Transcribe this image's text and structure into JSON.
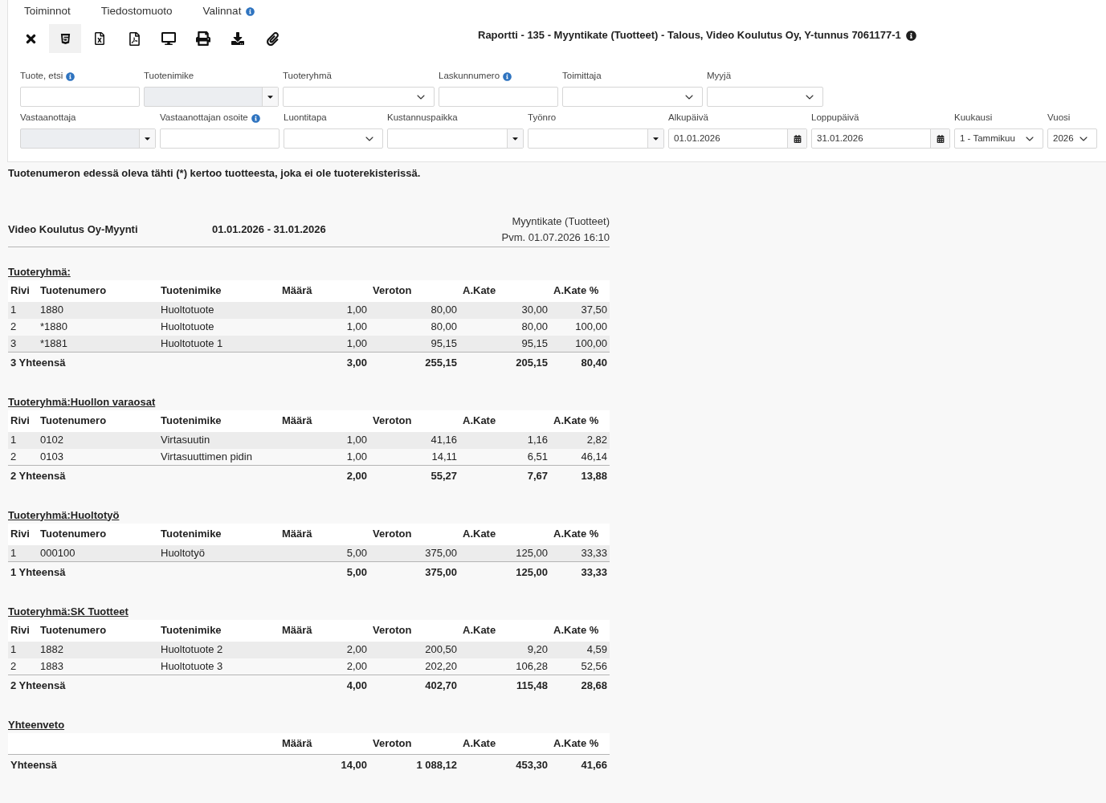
{
  "menu": [
    {
      "label": "Toiminnot",
      "info": false
    },
    {
      "label": "Tiedostomuoto",
      "info": false
    },
    {
      "label": "Valinnat",
      "info": true
    }
  ],
  "toolbar": [
    {
      "kind": "close",
      "selected": false
    },
    {
      "kind": "html",
      "selected": true
    },
    {
      "kind": "excel",
      "selected": false
    },
    {
      "kind": "pdf",
      "selected": false
    },
    {
      "kind": "screen",
      "selected": false
    },
    {
      "kind": "print",
      "selected": false
    },
    {
      "kind": "download",
      "selected": false
    },
    {
      "kind": "attach",
      "selected": false
    }
  ],
  "title": {
    "text": "Raportti - 135 - Myyntikate (Tuotteet) - Talous, Video Koulutus Oy, Y-tunnus 7061177-1",
    "info": true
  },
  "filter_rows": [
    [
      {
        "label": "Tuote, etsi",
        "info": true,
        "kind": "text",
        "disabled": false
      },
      {
        "label": "Tuotenimike",
        "info": false,
        "kind": "combo",
        "disabled": true
      },
      {
        "label": "Tuoteryhmä",
        "info": false,
        "kind": "select",
        "disabled": false
      },
      {
        "label": "Laskunnumero",
        "info": true,
        "kind": "text",
        "disabled": false
      },
      {
        "label": "Toimittaja",
        "info": false,
        "kind": "select",
        "disabled": false
      },
      {
        "label": "Myyjä",
        "info": false,
        "kind": "select",
        "disabled": false
      }
    ],
    [
      {
        "label": "Vastaanottaja",
        "info": false,
        "kind": "combo",
        "disabled": true
      },
      {
        "label": "Vastaanottajan osoite",
        "info": true,
        "kind": "text",
        "disabled": false
      },
      {
        "label": "Luontitapa",
        "info": false,
        "kind": "select",
        "disabled": false
      },
      {
        "label": "Kustannuspaikka",
        "info": false,
        "kind": "combo",
        "disabled": false
      },
      {
        "label": "Työnro",
        "info": false,
        "kind": "combo",
        "disabled": false
      },
      {
        "label": "Alkupäivä",
        "info": false,
        "kind": "date",
        "disabled": false,
        "value": "01.01.2026"
      },
      {
        "label": "Loppupäivä",
        "info": false,
        "kind": "date",
        "disabled": false,
        "value": "31.01.2026"
      },
      {
        "label": "Kuukausi",
        "info": false,
        "kind": "select",
        "disabled": false,
        "value": "1 - Tammikuu"
      },
      {
        "label": "Vuosi",
        "info": false,
        "kind": "select",
        "disabled": false,
        "value": "2026"
      }
    ]
  ],
  "note": "Tuotenumeron edessä oleva tähti (*) kertoo tuotteesta, joka ei ole tuoterekisterissä.",
  "report_header": {
    "company": "Video Koulutus Oy-Myynti",
    "period": "01.01.2026 - 31.01.2026",
    "report_name": "Myyntikate (Tuotteet)",
    "printed": "Pvm. 01.07.2026 16:10"
  },
  "groups": [
    {
      "heading": "Tuoteryhmä:",
      "columns": [
        "Rivi",
        "Tuotenumero",
        "Tuotenimike",
        "Määrä",
        "Veroton",
        "A.Kate",
        "A.Kate %"
      ],
      "rows": [
        [
          "1",
          "1880",
          "Huoltotuote",
          "1,00",
          "80,00",
          "30,00",
          "37,50"
        ],
        [
          "2",
          "*1880",
          "Huoltotuote",
          "1,00",
          "80,00",
          "80,00",
          "100,00"
        ],
        [
          "3",
          "*1881",
          "Huoltotuote 1",
          "1,00",
          "95,15",
          "95,15",
          "100,00"
        ]
      ],
      "total": [
        "3 Yhteensä",
        "3,00",
        "255,15",
        "205,15",
        "80,40"
      ]
    },
    {
      "heading": "Tuoteryhmä:Huollon varaosat",
      "columns": [
        "Rivi",
        "Tuotenumero",
        "Tuotenimike",
        "Määrä",
        "Veroton",
        "A.Kate",
        "A.Kate %"
      ],
      "rows": [
        [
          "1",
          "0102",
          "Virtasuutin",
          "1,00",
          "41,16",
          "1,16",
          "2,82"
        ],
        [
          "2",
          "0103",
          "Virtasuuttimen pidin",
          "1,00",
          "14,11",
          "6,51",
          "46,14"
        ]
      ],
      "total": [
        "2 Yhteensä",
        "2,00",
        "55,27",
        "7,67",
        "13,88"
      ]
    },
    {
      "heading": "Tuoteryhmä:Huoltotyö",
      "columns": [
        "Rivi",
        "Tuotenumero",
        "Tuotenimike",
        "Määrä",
        "Veroton",
        "A.Kate",
        "A.Kate %"
      ],
      "rows": [
        [
          "1",
          "000100",
          "Huoltotyö",
          "5,00",
          "375,00",
          "125,00",
          "33,33"
        ]
      ],
      "total": [
        "1 Yhteensä",
        "5,00",
        "375,00",
        "125,00",
        "33,33"
      ]
    },
    {
      "heading": "Tuoteryhmä:SK Tuotteet",
      "columns": [
        "Rivi",
        "Tuotenumero",
        "Tuotenimike",
        "Määrä",
        "Veroton",
        "A.Kate",
        "A.Kate %"
      ],
      "rows": [
        [
          "1",
          "1882",
          "Huoltotuote 2",
          "2,00",
          "200,50",
          "9,20",
          "4,59"
        ],
        [
          "2",
          "1883",
          "Huoltotuote 3",
          "2,00",
          "202,20",
          "106,28",
          "52,56"
        ]
      ],
      "total": [
        "2 Yhteensä",
        "4,00",
        "402,70",
        "115,48",
        "28,68"
      ]
    }
  ],
  "summary": {
    "heading": "Yhteenveto",
    "columns": [
      "Määrä",
      "Veroton",
      "A.Kate",
      "A.Kate %"
    ],
    "total": [
      "Yhteensä",
      "14,00",
      "1 088,12",
      "453,30",
      "41,66"
    ]
  }
}
